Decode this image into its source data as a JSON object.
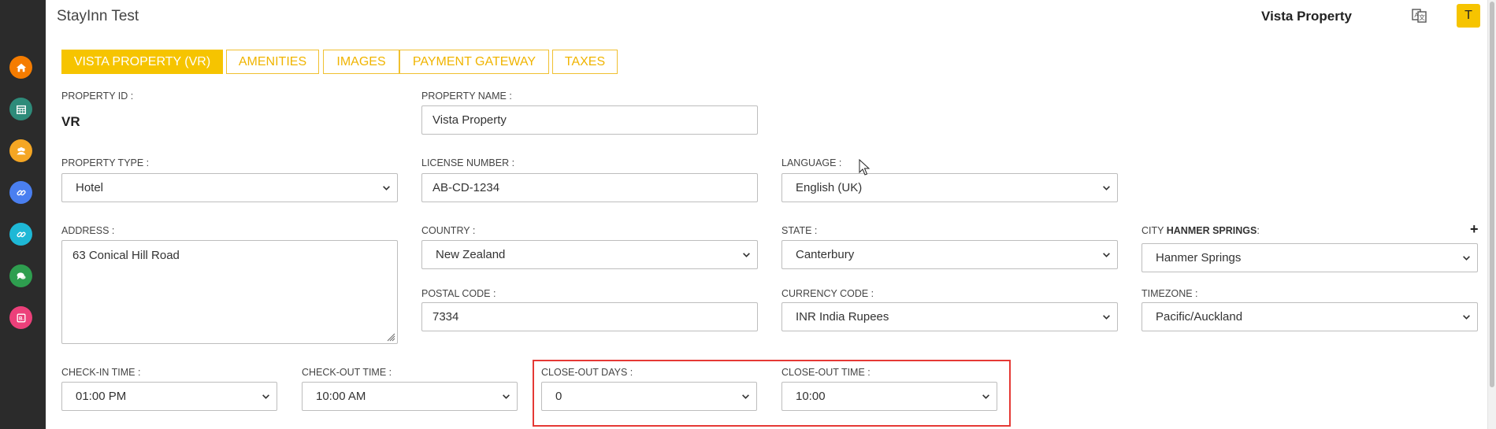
{
  "app": {
    "title": "StayInn Test",
    "property_name": "Vista Property",
    "avatar_letter": "T"
  },
  "sidebar": {
    "items": [
      {
        "icon": "home-icon",
        "color": "#f57c00"
      },
      {
        "icon": "calendar-icon",
        "color": "#2e8b7a"
      },
      {
        "icon": "users-icon",
        "color": "#f5a623"
      },
      {
        "icon": "link-icon",
        "color": "#4a7ff0"
      },
      {
        "icon": "link-icon",
        "color": "#1eb8d6"
      },
      {
        "icon": "chat-icon",
        "color": "#2e9e4f"
      },
      {
        "icon": "booking-icon",
        "color": "#ec407a"
      }
    ]
  },
  "tabs": [
    {
      "label": "VISTA PROPERTY (VR)",
      "active": true
    },
    {
      "label": "AMENITIES",
      "active": false
    },
    {
      "label": "IMAGES",
      "active": false
    },
    {
      "label": "PAYMENT GATEWAY",
      "active": false
    },
    {
      "label": "TAXES",
      "active": false
    }
  ],
  "form": {
    "property_id": {
      "label": "PROPERTY ID :",
      "value": "VR"
    },
    "property_name": {
      "label": "PROPERTY NAME :",
      "value": "Vista Property"
    },
    "property_type": {
      "label": "PROPERTY TYPE :",
      "value": "Hotel"
    },
    "license_number": {
      "label": "LICENSE NUMBER :",
      "value": "AB-CD-1234"
    },
    "language": {
      "label": "LANGUAGE :",
      "value": "English (UK)"
    },
    "address": {
      "label": "ADDRESS :",
      "value": "63 Conical Hill Road"
    },
    "country": {
      "label": "COUNTRY :",
      "value": "New Zealand"
    },
    "state": {
      "label": "STATE :",
      "value": "Canterbury"
    },
    "city": {
      "label_prefix": "CITY",
      "label_name": "HANMER SPRINGS",
      "label_suffix": ":",
      "value": "Hanmer Springs"
    },
    "postal_code": {
      "label": "POSTAL CODE :",
      "value": "7334"
    },
    "currency_code": {
      "label": "CURRENCY CODE :",
      "value": "INR India Rupees"
    },
    "timezone": {
      "label": "TIMEZONE :",
      "value": "Pacific/Auckland"
    },
    "check_in_time": {
      "label": "CHECK-IN TIME :",
      "value": "01:00 PM"
    },
    "check_out_time": {
      "label": "CHECK-OUT TIME :",
      "value": "10:00 AM"
    },
    "close_out_days": {
      "label": "CLOSE-OUT DAYS :",
      "value": "0"
    },
    "close_out_time": {
      "label": "CLOSE-OUT TIME :",
      "value": "10:00"
    }
  },
  "add_city_symbol": "+",
  "colors": {
    "accent": "#f6c400",
    "sidebar": "#2b2b2b",
    "highlight": "#e53935"
  }
}
